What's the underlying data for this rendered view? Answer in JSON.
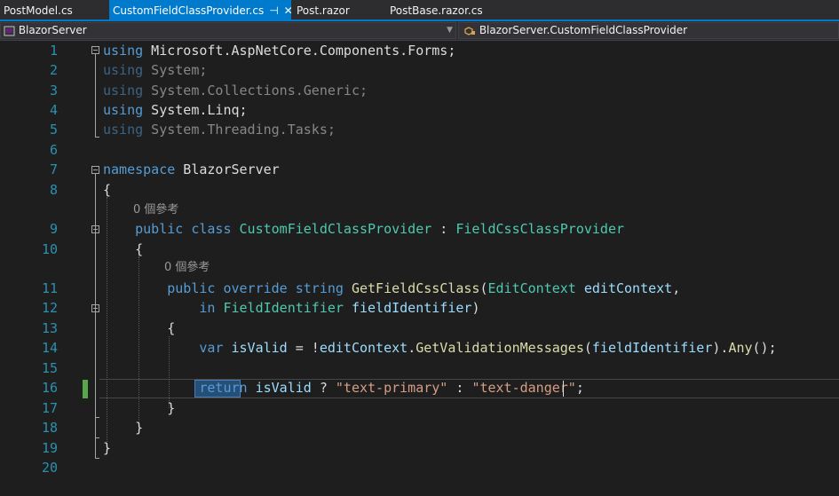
{
  "tabs": [
    {
      "label": "PostModel.cs"
    },
    {
      "label": "CustomFieldClassProvider.cs",
      "pin": "⊣",
      "close": "✕"
    },
    {
      "label": "Post.razor"
    },
    {
      "label": "PostBase.razor.cs"
    }
  ],
  "navbar": {
    "project": "BlazorServer",
    "member": "BlazorServer.CustomFieldClassProvider"
  },
  "refs": {
    "class_refs": "0 個參考",
    "method_refs": "0 個參考"
  },
  "lines": [
    {
      "n": "1",
      "html": "<span class=\"kw\">using</span> Microsoft.AspNetCore.Components.Forms;"
    },
    {
      "n": "2",
      "html": "<span class=\"dim\"><span class=\"kw\">using</span> System;</span>"
    },
    {
      "n": "3",
      "html": "<span class=\"dim\"><span class=\"kw\">using</span> System.Collections.Generic;</span>"
    },
    {
      "n": "4",
      "html": "<span class=\"kw\">using</span> System.Linq;"
    },
    {
      "n": "5",
      "html": "<span class=\"dim\"><span class=\"kw\">using</span> System.Threading.Tasks;</span>"
    },
    {
      "n": "6",
      "html": ""
    },
    {
      "n": "7",
      "html": "<span class=\"kw\">namespace</span> BlazorServer"
    },
    {
      "n": "8",
      "html": "{"
    },
    {
      "n": "9",
      "html": "    <span class=\"kw\">public</span> <span class=\"kw\">class</span> <span class=\"ty\">CustomFieldClassProvider</span> : <span class=\"ty\">FieldCssClassProvider</span>"
    },
    {
      "n": "10",
      "html": "    {"
    },
    {
      "n": "11",
      "html": "        <span class=\"kw\">public</span> <span class=\"kw\">override</span> <span class=\"kw\">string</span> <span class=\"me\">GetFieldCssClass</span>(<span class=\"ty\">EditContext</span> <span class=\"va\">editContext</span>,"
    },
    {
      "n": "12",
      "html": "            <span class=\"kw\">in</span> <span class=\"ty\">FieldIdentifier</span> <span class=\"va\">fieldIdentifier</span>)"
    },
    {
      "n": "13",
      "html": "        {"
    },
    {
      "n": "14",
      "html": "            <span class=\"kw\">var</span> <span class=\"va\">isValid</span> = !<span class=\"va\">editContext</span>.<span class=\"me\">GetValidationMessages</span>(<span class=\"va\">fieldIdentifier</span>).<span class=\"me\">Any</span>();"
    },
    {
      "n": "15",
      "html": ""
    },
    {
      "n": "16",
      "html": "            <span class=\"kw\">return</span> <span class=\"va\">isValid</span> ? <span class=\"st\">\"text-primary\"</span> : <span class=\"st\">\"text-danger\"</span>;"
    },
    {
      "n": "17",
      "html": "        }"
    },
    {
      "n": "18",
      "html": "    }"
    },
    {
      "n": "19",
      "html": "}"
    },
    {
      "n": "20",
      "html": ""
    }
  ]
}
